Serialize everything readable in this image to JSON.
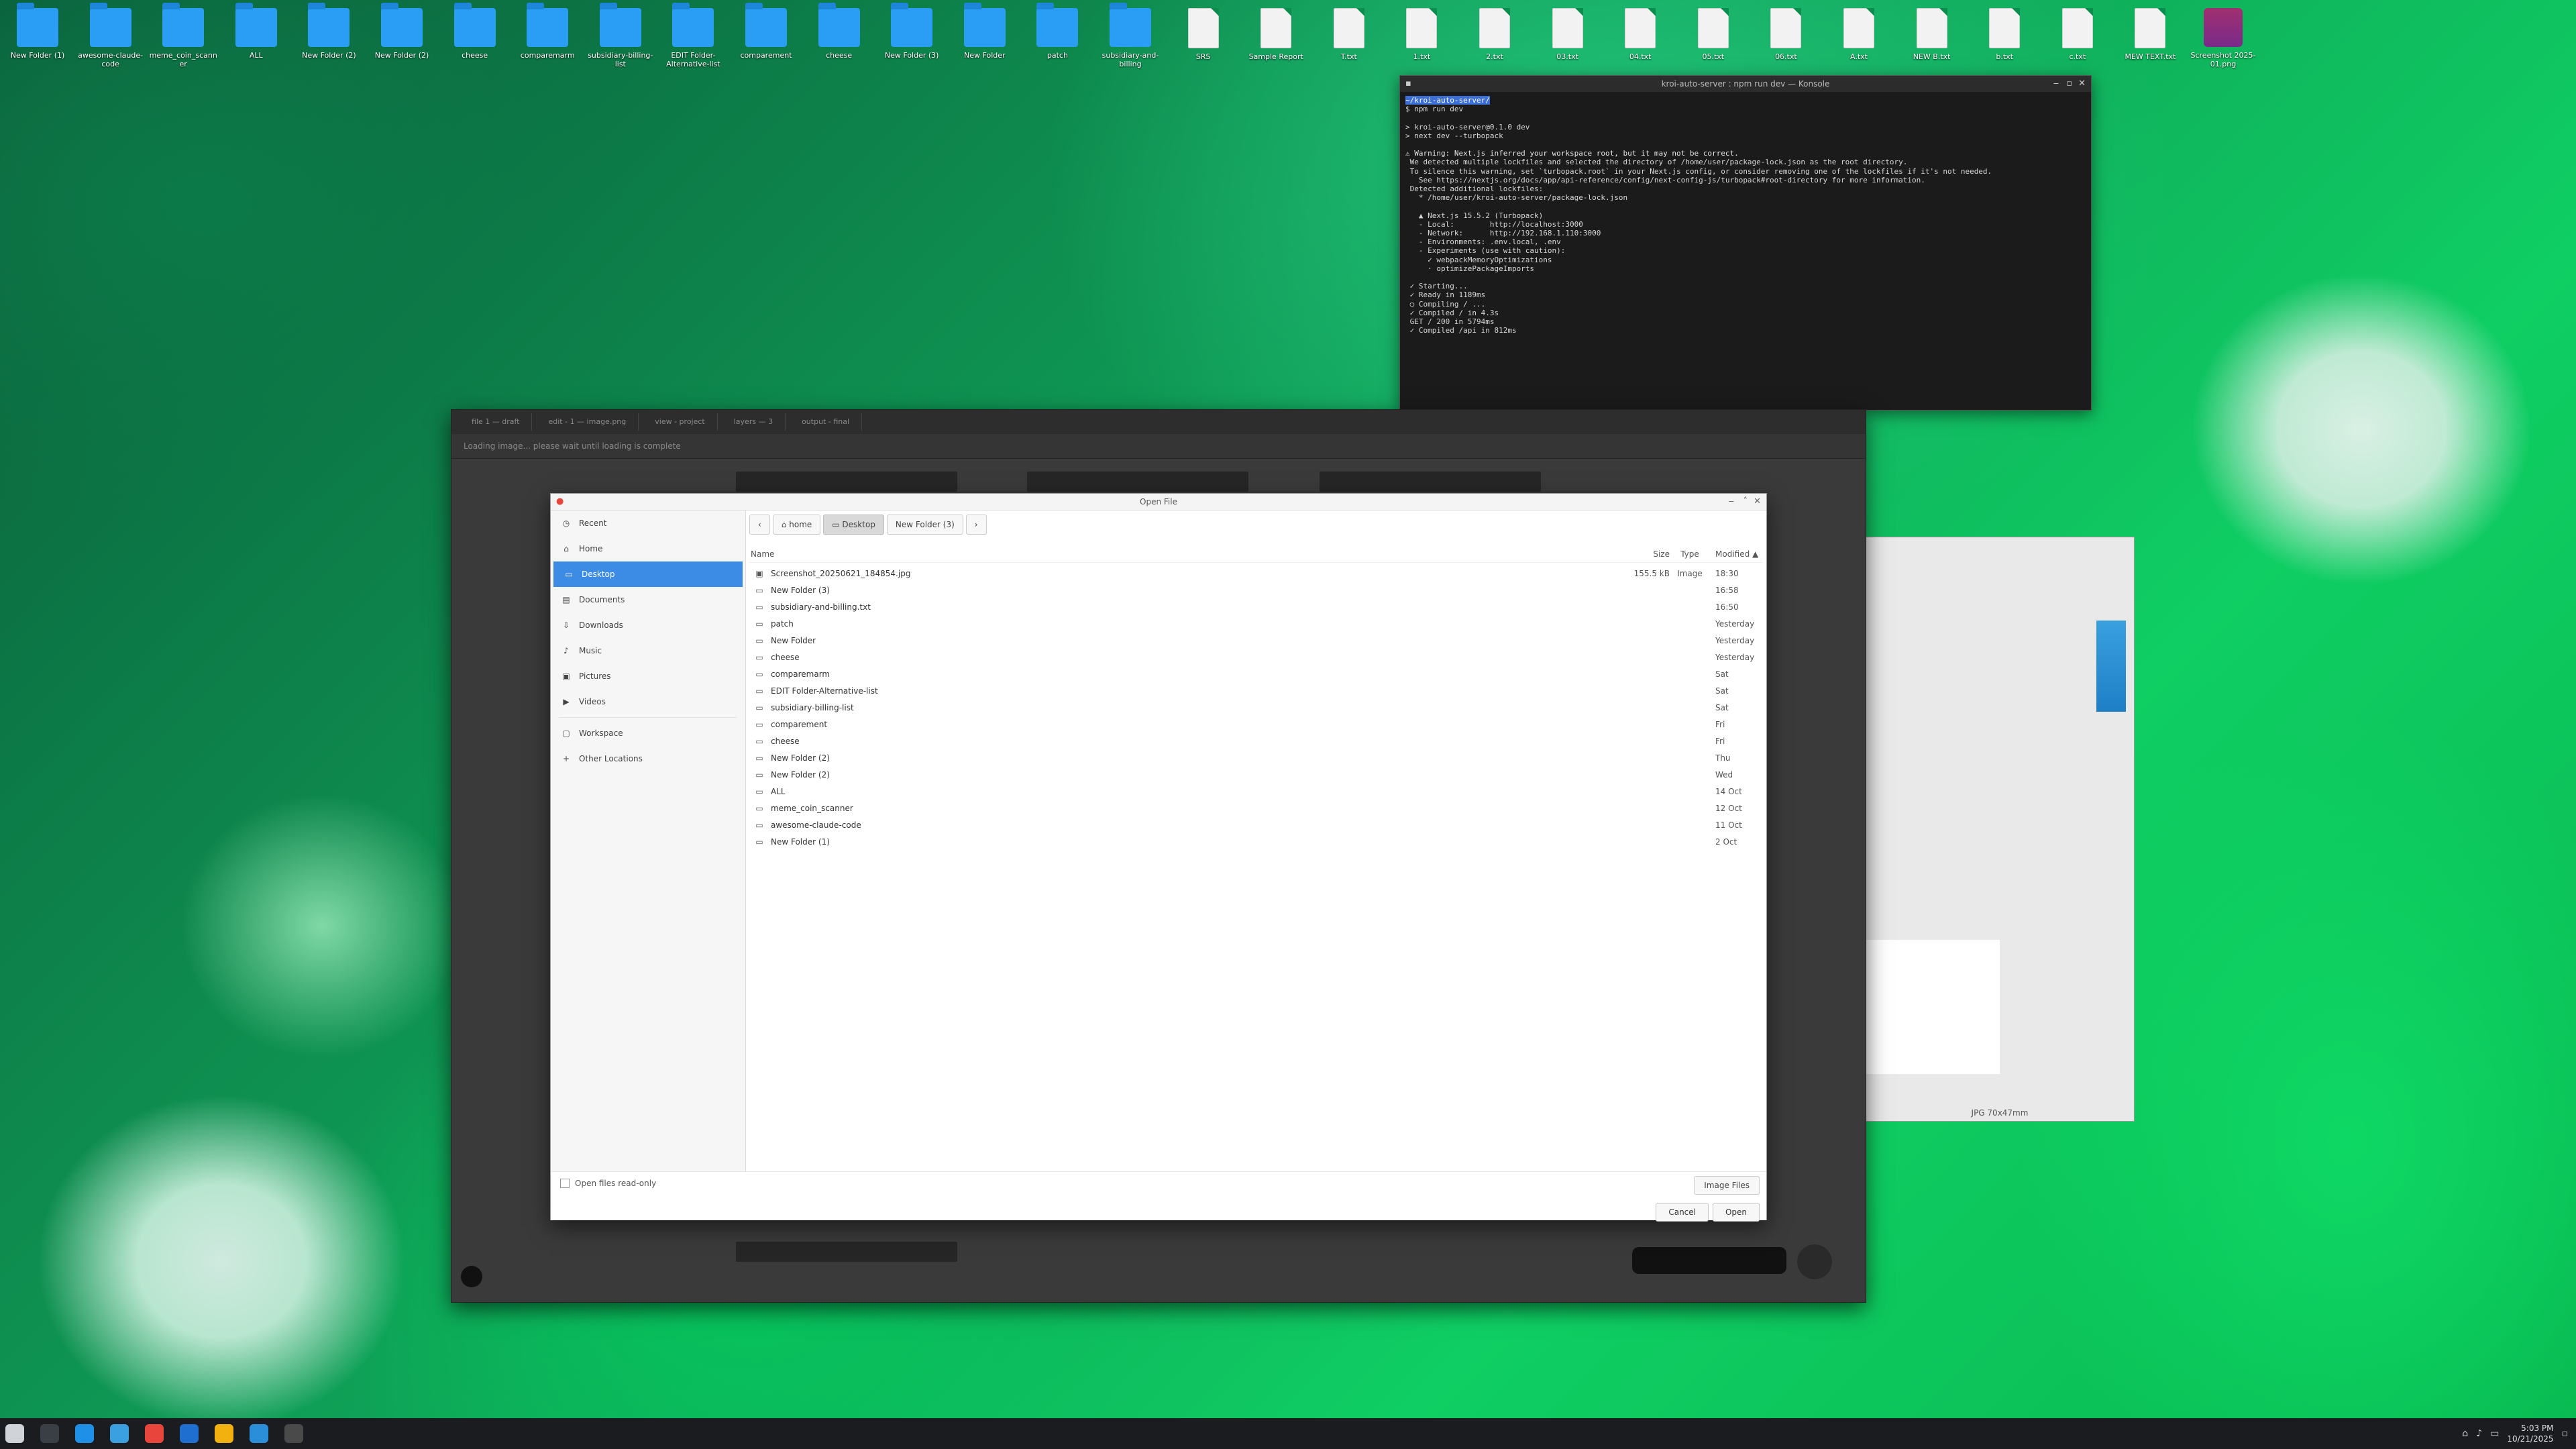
{
  "desktop_icons": [
    {
      "name": "folder-icon",
      "label": "New Folder (1)"
    },
    {
      "name": "folder-icon",
      "label": "awesome-claude-code"
    },
    {
      "name": "folder-icon",
      "label": "meme_coin_scanner"
    },
    {
      "name": "folder-icon",
      "label": "ALL"
    },
    {
      "name": "folder-icon",
      "label": "New Folder (2)"
    },
    {
      "name": "folder-icon",
      "label": "New Folder (2)"
    },
    {
      "name": "folder-icon",
      "label": "cheese"
    },
    {
      "name": "folder-icon",
      "label": "comparemarm"
    },
    {
      "name": "folder-icon",
      "label": "subsidiary-billing-list"
    },
    {
      "name": "folder-icon",
      "label": "EDIT Folder-Alternative-list"
    },
    {
      "name": "folder-icon",
      "label": "comparement"
    },
    {
      "name": "folder-icon",
      "label": "cheese"
    },
    {
      "name": "folder-icon",
      "label": "New Folder (3)"
    },
    {
      "name": "folder-icon",
      "label": "New Folder"
    },
    {
      "name": "folder-icon",
      "label": "patch"
    },
    {
      "name": "folder-icon",
      "label": "subsidiary-and-billing"
    },
    {
      "name": "file-icon",
      "label": "SRS"
    },
    {
      "name": "file-icon",
      "label": "Sample Report"
    },
    {
      "name": "file-icon",
      "label": "T.txt"
    },
    {
      "name": "file-icon",
      "label": "1.txt"
    },
    {
      "name": "file-icon",
      "label": "2.txt"
    },
    {
      "name": "file-icon",
      "label": "03.txt"
    },
    {
      "name": "file-icon",
      "label": "04.txt"
    },
    {
      "name": "file-icon",
      "label": "05.txt"
    },
    {
      "name": "file-icon",
      "label": "06.txt"
    },
    {
      "name": "file-icon",
      "label": "A.txt"
    },
    {
      "name": "file-icon",
      "label": "NEW B.txt"
    },
    {
      "name": "file-icon",
      "label": "b.txt"
    },
    {
      "name": "file-icon",
      "label": "c.txt"
    },
    {
      "name": "file-icon",
      "label": "MEW TEXT.txt"
    },
    {
      "name": "app-icon",
      "label": "Screenshot 2025-01.png"
    }
  ],
  "terminal": {
    "title": "kroi-auto-server : npm run dev — Konsole",
    "lines": [
      {
        "t": "~/kroi-auto-server/",
        "cls": "sel"
      },
      {
        "t": "$ npm run dev",
        "cls": ""
      },
      {
        "t": "",
        "cls": ""
      },
      {
        "t": "> kroi-auto-server@0.1.0 dev",
        "cls": ""
      },
      {
        "t": "> next dev --turbopack",
        "cls": ""
      },
      {
        "t": "",
        "cls": ""
      },
      {
        "t": "⚠ Warning: Next.js inferred your workspace root, but it may not be correct.",
        "cls": "warn"
      },
      {
        "t": " We detected multiple lockfiles and selected the directory of /home/user/package-lock.json as the root directory.",
        "cls": ""
      },
      {
        "t": " To silence this warning, set `turbopack.root` in your Next.js config, or consider removing one of the lockfiles if it's not needed.",
        "cls": ""
      },
      {
        "t": "   See https://nextjs.org/docs/app/api-reference/config/next-config-js/turbopack#root-directory for more information.",
        "cls": ""
      },
      {
        "t": " Detected additional lockfiles:",
        "cls": ""
      },
      {
        "t": "   * /home/user/kroi-auto-server/package-lock.json",
        "cls": ""
      },
      {
        "t": "",
        "cls": ""
      },
      {
        "t": "   ▲ Next.js 15.5.2 (Turbopack)",
        "cls": ""
      },
      {
        "t": "   - Local:        http://localhost:3000",
        "cls": ""
      },
      {
        "t": "   - Network:      http://192.168.1.110:3000",
        "cls": ""
      },
      {
        "t": "   - Environments: .env.local, .env",
        "cls": ""
      },
      {
        "t": "   - Experiments (use with caution):",
        "cls": ""
      },
      {
        "t": "     ✓ webpackMemoryOptimizations",
        "cls": ""
      },
      {
        "t": "     · optimizePackageImports",
        "cls": ""
      },
      {
        "t": "",
        "cls": ""
      },
      {
        "t": " ✓ Starting...",
        "cls": ""
      },
      {
        "t": " ✓ Ready in 1189ms",
        "cls": ""
      },
      {
        "t": " ○ Compiling / ...",
        "cls": ""
      },
      {
        "t": " ✓ Compiled / in 4.3s",
        "cls": ""
      },
      {
        "t": " GET / 200 in 5794ms",
        "cls": ""
      },
      {
        "t": " ✓ Compiled /api in 812ms",
        "cls": ""
      }
    ]
  },
  "editor": {
    "tabs": [
      "file 1 — draft",
      "edit - 1 — image.png",
      "view - project",
      "layers — 3",
      "output - final"
    ],
    "toolbar_text": "Loading image... please wait until loading is complete"
  },
  "dialog": {
    "title": "Open File",
    "places": [
      {
        "icon": "clock-icon",
        "glyph": "◷",
        "label": "Recent"
      },
      {
        "icon": "home-icon",
        "glyph": "⌂",
        "label": "Home"
      },
      {
        "icon": "desktop-icon",
        "glyph": "▭",
        "label": "Desktop",
        "active": true
      },
      {
        "icon": "documents-icon",
        "glyph": "▤",
        "label": "Documents"
      },
      {
        "icon": "downloads-icon",
        "glyph": "⇩",
        "label": "Downloads"
      },
      {
        "icon": "music-icon",
        "glyph": "♪",
        "label": "Music"
      },
      {
        "icon": "pictures-icon",
        "glyph": "▣",
        "label": "Pictures"
      },
      {
        "icon": "videos-icon",
        "glyph": "▶",
        "label": "Videos"
      },
      {
        "icon": "workspace-icon",
        "glyph": "▢",
        "label": "Workspace",
        "sep_before": true
      },
      {
        "icon": "plus-icon",
        "glyph": "+",
        "label": "Other Locations"
      }
    ],
    "crumbs": [
      "⌂ home",
      "▭ Desktop",
      "New Folder (3)"
    ],
    "columns": {
      "name": "Name",
      "size": "Size",
      "type": "Type",
      "modified": "Modified ▲"
    },
    "files": [
      {
        "kind": "image",
        "name": "Screenshot_20250621_184854.jpg",
        "size": "155.5 kB",
        "type": "Image",
        "modified": "18:30"
      },
      {
        "kind": "folder",
        "name": "New Folder (3)",
        "size": "",
        "type": "",
        "modified": "16:58"
      },
      {
        "kind": "folder",
        "name": "subsidiary-and-billing.txt",
        "size": "",
        "type": "",
        "modified": "16:50"
      },
      {
        "kind": "folder",
        "name": "patch",
        "size": "",
        "type": "",
        "modified": "Yesterday"
      },
      {
        "kind": "folder",
        "name": "New Folder",
        "size": "",
        "type": "",
        "modified": "Yesterday"
      },
      {
        "kind": "folder",
        "name": "cheese",
        "size": "",
        "type": "",
        "modified": "Yesterday"
      },
      {
        "kind": "folder",
        "name": "comparemarm",
        "size": "",
        "type": "",
        "modified": "Sat"
      },
      {
        "kind": "folder",
        "name": "EDIT Folder-Alternative-list",
        "size": "",
        "type": "",
        "modified": "Sat"
      },
      {
        "kind": "folder",
        "name": "subsidiary-billing-list",
        "size": "",
        "type": "",
        "modified": "Sat"
      },
      {
        "kind": "folder",
        "name": "comparement",
        "size": "",
        "type": "",
        "modified": "Fri"
      },
      {
        "kind": "folder",
        "name": "cheese",
        "size": "",
        "type": "",
        "modified": "Fri"
      },
      {
        "kind": "folder",
        "name": "New Folder (2)",
        "size": "",
        "type": "",
        "modified": "Thu"
      },
      {
        "kind": "folder",
        "name": "New Folder (2)",
        "size": "",
        "type": "",
        "modified": "Wed"
      },
      {
        "kind": "folder",
        "name": "ALL",
        "size": "",
        "type": "",
        "modified": "14 Oct"
      },
      {
        "kind": "folder",
        "name": "meme_coin_scanner",
        "size": "",
        "type": "",
        "modified": "12 Oct"
      },
      {
        "kind": "folder",
        "name": "awesome-claude-code",
        "size": "",
        "type": "",
        "modified": "11 Oct"
      },
      {
        "kind": "folder",
        "name": "New Folder (1)",
        "size": "",
        "type": "",
        "modified": "2 Oct"
      }
    ],
    "readonly_label": "Open files read-only",
    "filter_label": "Image Files",
    "cancel_label": "Cancel",
    "open_label": "Open"
  },
  "side_window": {
    "bottom_label": "JPG 70x47mm"
  },
  "taskbar": {
    "apps": [
      {
        "name": "app-launcher-icon",
        "color": "#d0d4d8"
      },
      {
        "name": "terminal-icon",
        "color": "#3a3f46"
      },
      {
        "name": "blue-app-icon",
        "color": "#1e90e8"
      },
      {
        "name": "file-manager-icon",
        "color": "#3aa0e0"
      },
      {
        "name": "chrome-icon",
        "color": "#e8453c"
      },
      {
        "name": "browser-icon",
        "color": "#1e6fd0"
      },
      {
        "name": "chrome-2-icon",
        "color": "#f2b10f"
      },
      {
        "name": "editor-icon",
        "color": "#2b8ed8"
      },
      {
        "name": "dark-app-icon",
        "color": "#4a4a4a"
      }
    ],
    "time": "5:03 PM",
    "date": "10/21/2025"
  }
}
